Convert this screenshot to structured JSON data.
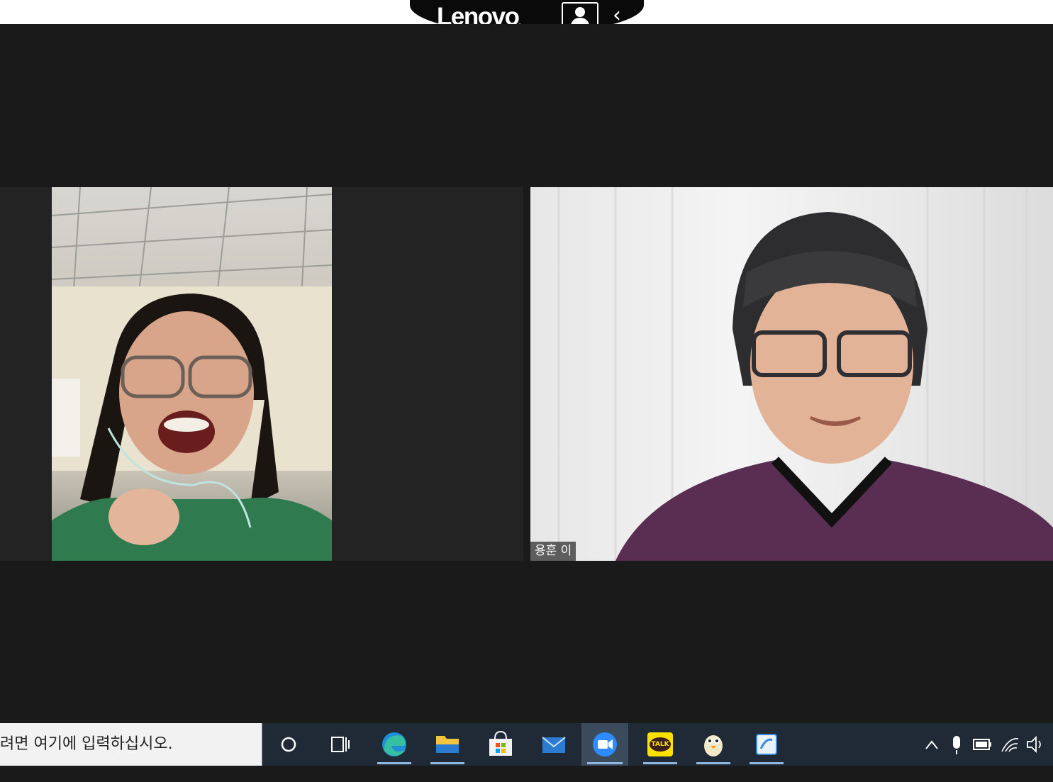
{
  "lenovo_bar": {
    "logo_text": "Lenovo",
    "logo_mark": "."
  },
  "meeting": {
    "participants": [
      {
        "name": ""
      },
      {
        "name": "용훈 이"
      }
    ]
  },
  "taskbar": {
    "search_placeholder": "려면 여기에 입력하십시오.",
    "apps": [
      {
        "name": "cortana",
        "icon": "circle-icon"
      },
      {
        "name": "task-view",
        "icon": "task-view-icon"
      },
      {
        "name": "edge",
        "icon": "edge-icon"
      },
      {
        "name": "file-explorer",
        "icon": "folder-icon"
      },
      {
        "name": "store",
        "icon": "store-icon"
      },
      {
        "name": "mail",
        "icon": "mail-icon"
      },
      {
        "name": "zoom",
        "icon": "zoom-icon"
      },
      {
        "name": "kakaotalk",
        "icon": "kakaotalk-icon",
        "label": "TALK"
      },
      {
        "name": "penguin-app",
        "icon": "penguin-icon"
      },
      {
        "name": "hwp",
        "icon": "hwp-icon"
      }
    ],
    "tray": [
      "chevron-up-icon",
      "microphone-icon",
      "battery-icon",
      "wifi-icon",
      "speaker-icon"
    ]
  },
  "colors": {
    "meeting_bg": "#1a1a1a",
    "taskbar_bg": "#1f2a36",
    "accent_underline": "#8fb8df"
  }
}
